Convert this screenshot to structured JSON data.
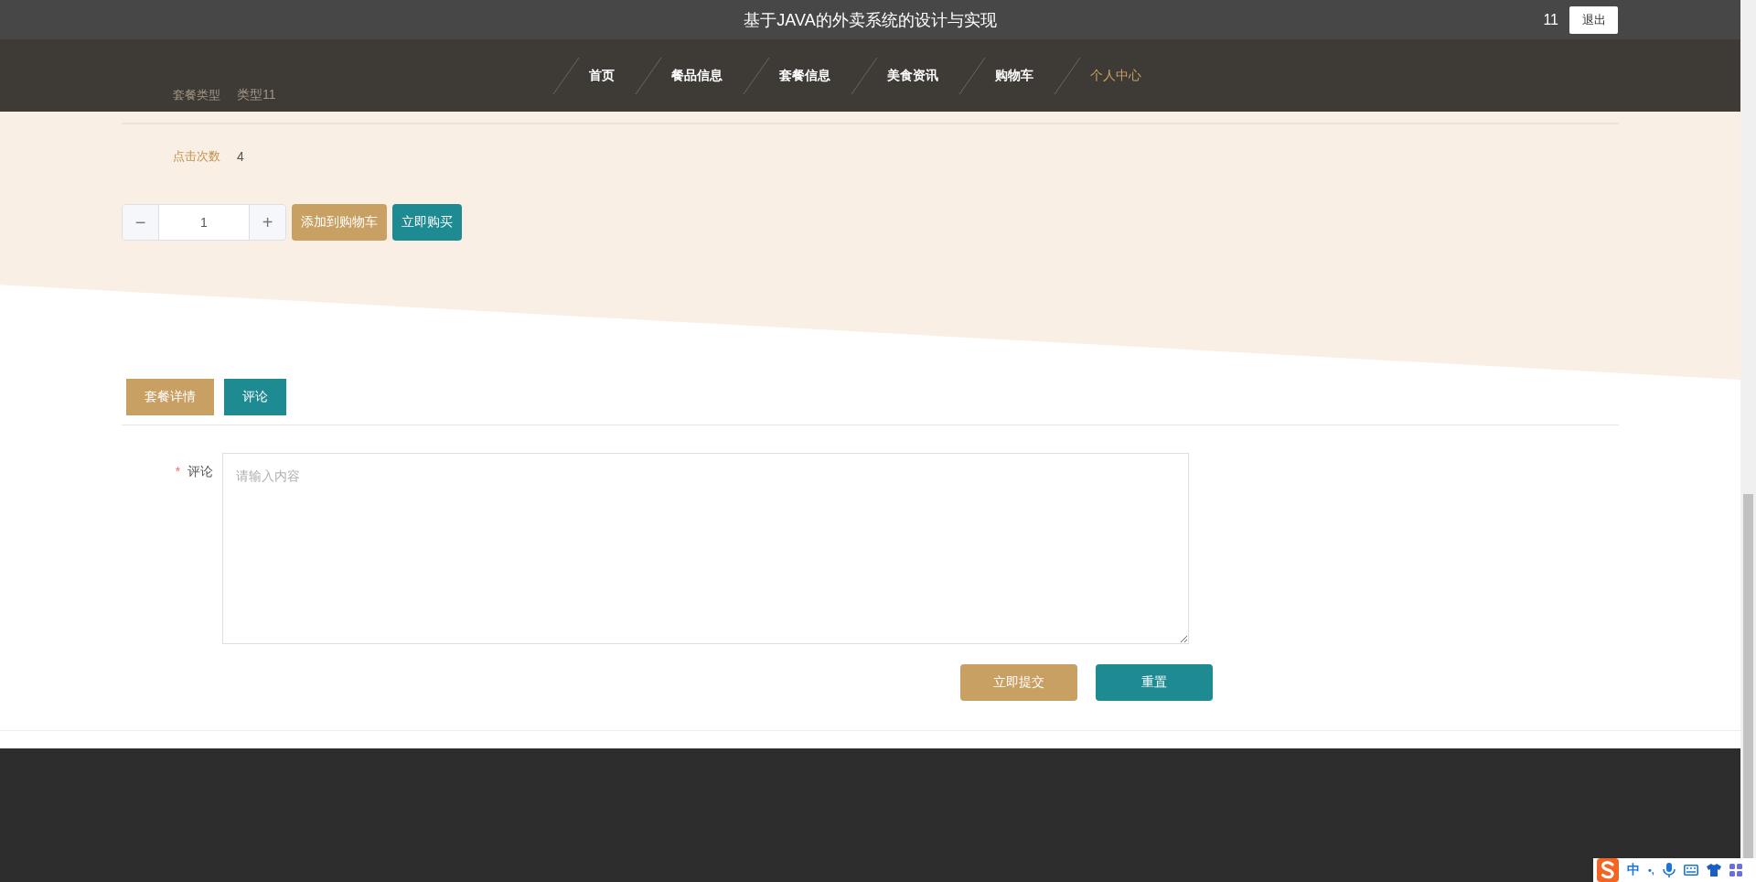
{
  "header": {
    "title": "基于JAVA的外卖系统的设计与实现",
    "username": "11",
    "logout": "退出"
  },
  "nav": [
    {
      "label": "首页",
      "selected": false
    },
    {
      "label": "餐品信息",
      "selected": false
    },
    {
      "label": "套餐信息",
      "selected": false
    },
    {
      "label": "美食资讯",
      "selected": false
    },
    {
      "label": "购物车",
      "selected": false
    },
    {
      "label": "个人中心",
      "selected": true
    }
  ],
  "details": [
    {
      "label": "套餐类型",
      "value": "类型11"
    },
    {
      "label": "点击次数",
      "value": "4"
    }
  ],
  "quantity": {
    "minus": "−",
    "value": "1",
    "plus": "+"
  },
  "actions": {
    "add_to_cart": "添加到购物车",
    "buy_now": "立即购买"
  },
  "tabs": [
    {
      "label": "套餐详情",
      "selected": false
    },
    {
      "label": "评论",
      "selected": true
    }
  ],
  "form": {
    "required_mark": "*",
    "label": "评论",
    "placeholder": "请输入内容",
    "submit": "立即提交",
    "reset": "重置"
  },
  "ime_toolbar": {
    "mode": "中",
    "punctuation": "•,"
  }
}
